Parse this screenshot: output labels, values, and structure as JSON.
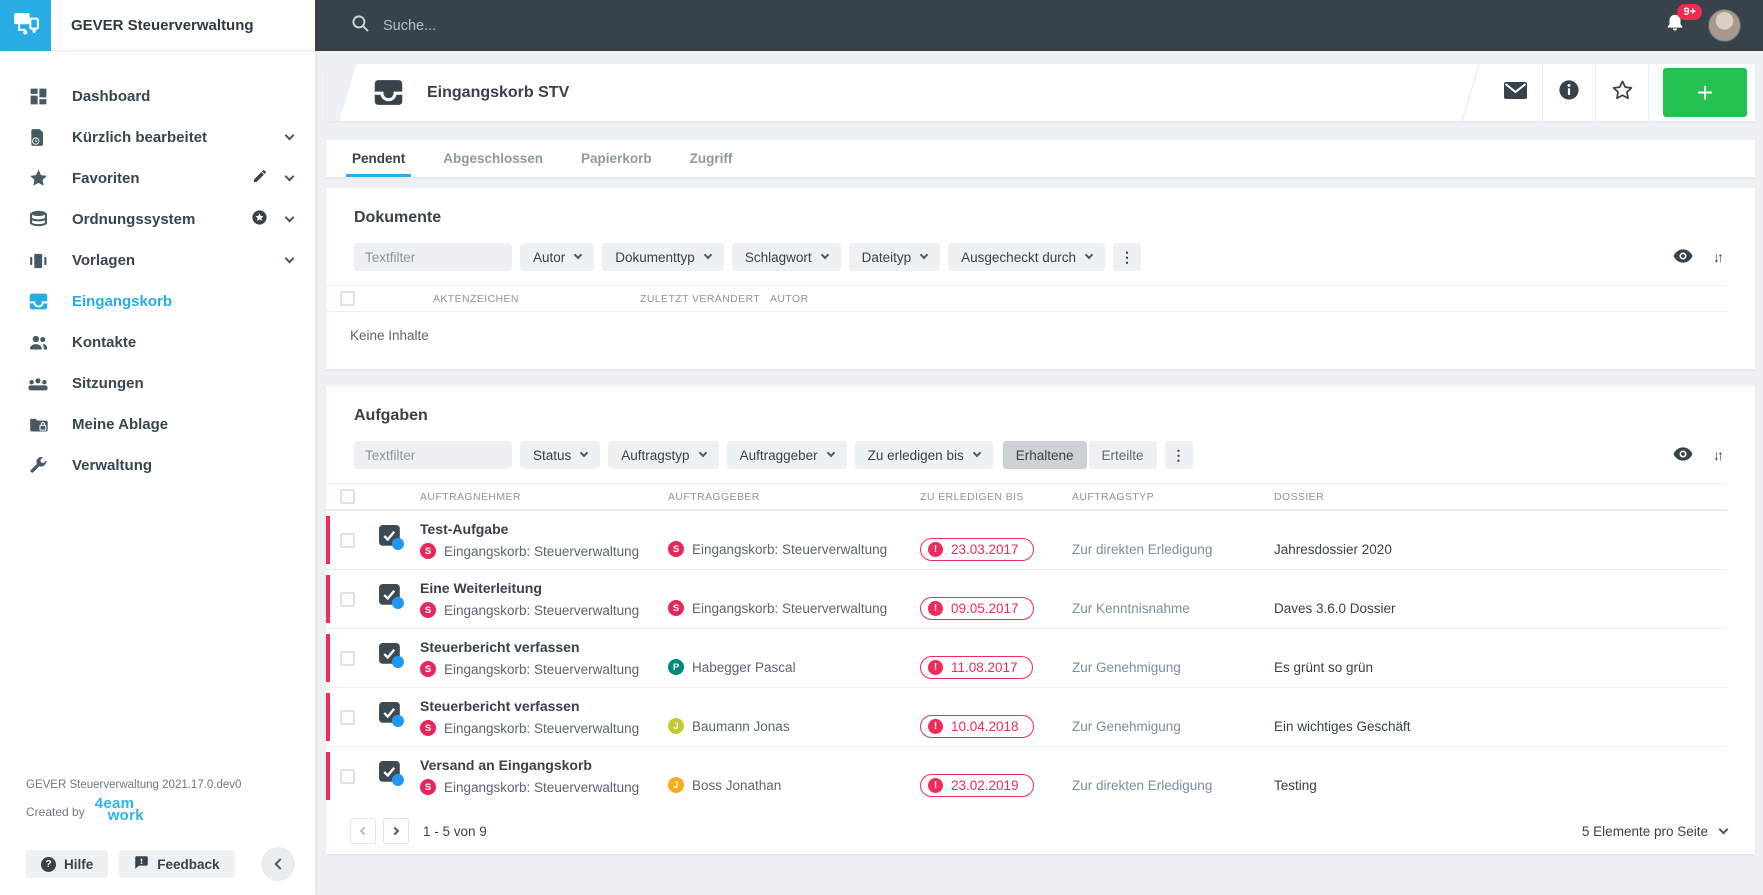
{
  "app": {
    "title": "GEVER Steuerverwaltung"
  },
  "colors": {
    "accent": "#27ace4",
    "topbar": "#37424a",
    "green": "#25c150",
    "red": "#ef2b5c"
  },
  "icons": {
    "plus": "+",
    "kebab": "⋮",
    "sort": "↓↑",
    "help": "?",
    "overdue": "!"
  },
  "topbar": {
    "search_placeholder": "Suche...",
    "notification_count": "9+"
  },
  "sidebar": {
    "items": [
      {
        "label": "Dashboard"
      },
      {
        "label": "Kürzlich bearbeitet"
      },
      {
        "label": "Favoriten"
      },
      {
        "label": "Ordnungssystem"
      },
      {
        "label": "Vorlagen"
      },
      {
        "label": "Eingangskorb",
        "active": true
      },
      {
        "label": "Kontakte"
      },
      {
        "label": "Sitzungen"
      },
      {
        "label": "Meine Ablage"
      },
      {
        "label": "Verwaltung"
      }
    ],
    "footer": {
      "version": "GEVER Steuerverwaltung 2021.17.0.dev0",
      "created_by": "Created by",
      "brand_top": "4eam",
      "brand_bottom": "work",
      "help": "Hilfe",
      "feedback": "Feedback"
    }
  },
  "page": {
    "title": "Eingangskorb STV",
    "tabs": [
      {
        "label": "Pendent",
        "active": true
      },
      {
        "label": "Abgeschlossen"
      },
      {
        "label": "Papierkorb"
      },
      {
        "label": "Zugriff"
      }
    ]
  },
  "documents": {
    "title": "Dokumente",
    "textfilter_placeholder": "Textfilter",
    "filters": [
      "Autor",
      "Dokumenttyp",
      "Schlagwort",
      "Dateityp",
      "Ausgecheckt durch"
    ],
    "columns": [
      "AKTENZEICHEN",
      "ZULETZT VERÄNDERT",
      "AUTOR"
    ],
    "empty_text": "Keine Inhalte"
  },
  "tasks": {
    "title": "Aufgaben",
    "textfilter_placeholder": "Textfilter",
    "filters": [
      "Status",
      "Auftragstyp",
      "Auftraggeber",
      "Zu erledigen bis"
    ],
    "toggle": {
      "received": "Erhaltene",
      "issued": "Erteilte"
    },
    "columns": [
      "AUFTRAGNEHMER",
      "AUFTRAGGEBER",
      "ZU ERLEDIGEN BIS",
      "AUFTRAGSTYP",
      "DOSSIER"
    ],
    "rows": [
      {
        "title": "Test-Aufgabe",
        "assignee": {
          "initial": "S",
          "color": "#e9265a",
          "name": "Eingangskorb: Steuerverwaltung"
        },
        "issuer": {
          "initial": "S",
          "color": "#e9265a",
          "name": "Eingangskorb: Steuerverwaltung"
        },
        "due": "23.03.2017",
        "type": "Zur direkten Erledigung",
        "dossier": "Jahresdossier 2020"
      },
      {
        "title": "Eine Weiterleitung",
        "assignee": {
          "initial": "S",
          "color": "#e9265a",
          "name": "Eingangskorb: Steuerverwaltung"
        },
        "issuer": {
          "initial": "S",
          "color": "#e9265a",
          "name": "Eingangskorb: Steuerverwaltung"
        },
        "due": "09.05.2017",
        "type": "Zur Kenntnisnahme",
        "dossier": "Daves 3.6.0 Dossier"
      },
      {
        "title": "Steuerbericht verfassen",
        "assignee": {
          "initial": "S",
          "color": "#e9265a",
          "name": "Eingangskorb: Steuerverwaltung"
        },
        "issuer": {
          "initial": "P",
          "color": "#00897b",
          "name": "Habegger Pascal"
        },
        "due": "11.08.2017",
        "type": "Zur Genehmigung",
        "dossier": "Es grünt so grün"
      },
      {
        "title": "Steuerbericht verfassen",
        "assignee": {
          "initial": "S",
          "color": "#e9265a",
          "name": "Eingangskorb: Steuerverwaltung"
        },
        "issuer": {
          "initial": "J",
          "color": "#c0ca33",
          "name": "Baumann Jonas"
        },
        "due": "10.04.2018",
        "type": "Zur Genehmigung",
        "dossier": "Ein wichtiges Geschäft"
      },
      {
        "title": "Versand an Eingangskorb",
        "assignee": {
          "initial": "S",
          "color": "#e9265a",
          "name": "Eingangskorb: Steuerverwaltung"
        },
        "issuer": {
          "initial": "J",
          "color": "#f7ac16",
          "name": "Boss Jonathan"
        },
        "due": "23.02.2019",
        "type": "Zur direkten Erledigung",
        "dossier": "Testing"
      }
    ],
    "pagination": {
      "range": "1 - 5 von 9",
      "per_page": "5 Elemente pro Seite"
    }
  }
}
